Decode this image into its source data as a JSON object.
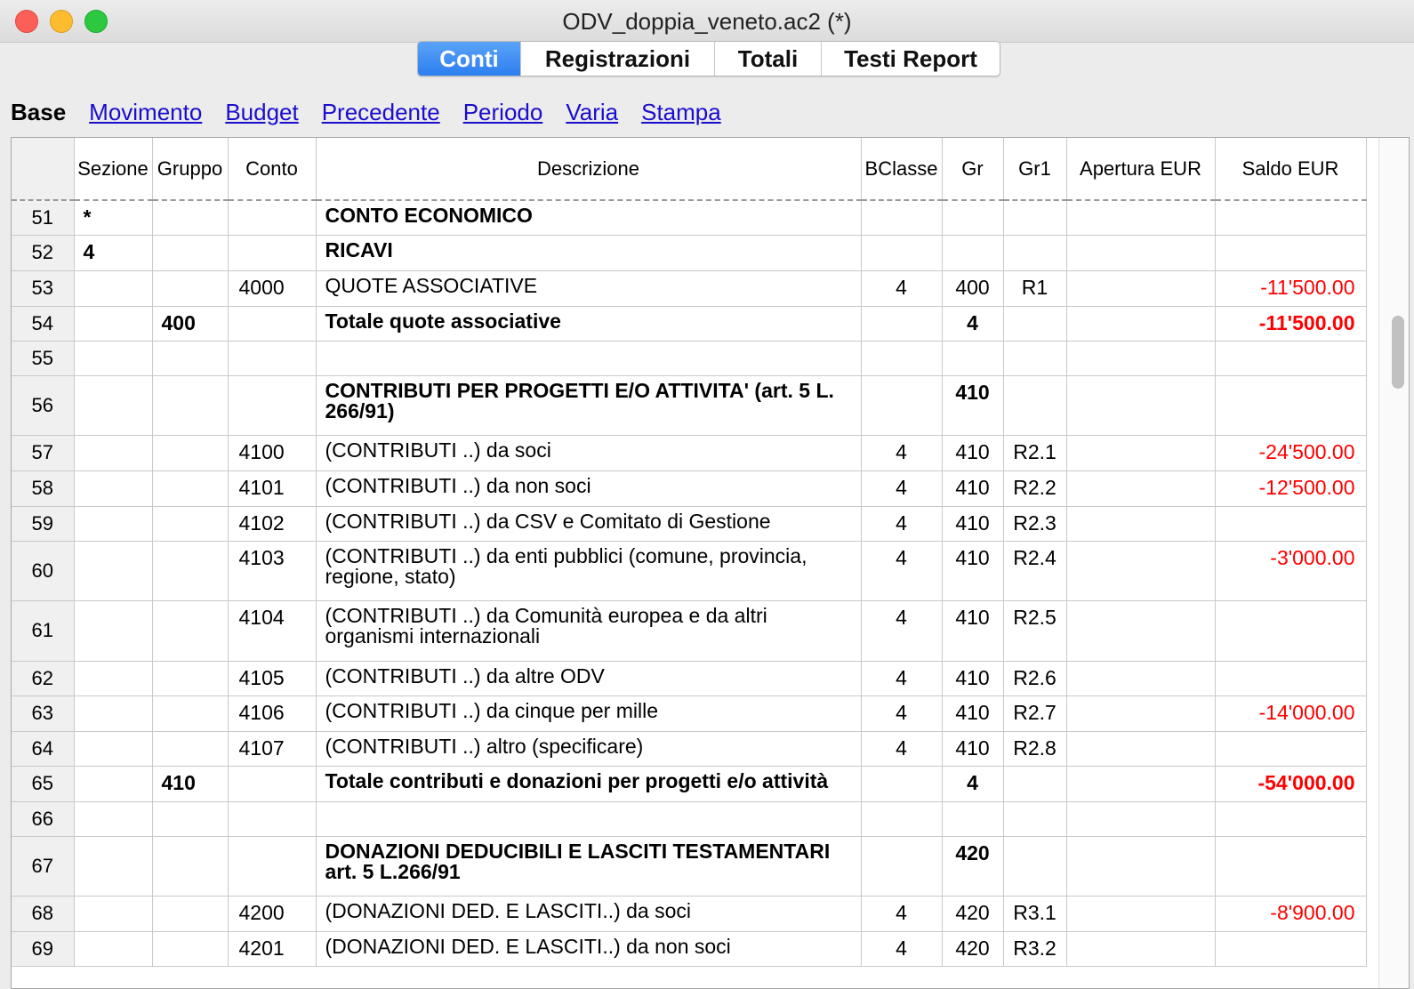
{
  "window": {
    "title": "ODV_doppia_veneto.ac2 (*)"
  },
  "tabs": [
    "Conti",
    "Registrazioni",
    "Totali",
    "Testi Report"
  ],
  "active_tab": "Conti",
  "views": {
    "base": "Base",
    "links": [
      "Movimento",
      "Budget",
      "Precedente",
      "Periodo",
      "Varia",
      "Stampa"
    ]
  },
  "columns": [
    "Sezione",
    "Gruppo",
    "Conto",
    "Descrizione",
    "BClasse",
    "Gr",
    "Gr1",
    "Apertura EUR",
    "Saldo EUR"
  ],
  "colors": {
    "negative": "#ff0000",
    "tab_active": "#2d7ff0",
    "link": "#1a0dcc"
  },
  "rows": [
    {
      "n": "51",
      "sezione": "*",
      "gruppo": "",
      "conto": "",
      "descrizione": "CONTO ECONOMICO",
      "bclasse": "",
      "gr": "",
      "gr1": "",
      "apertura": "",
      "saldo": "",
      "bold": true,
      "h": 39
    },
    {
      "n": "52",
      "sezione": "4",
      "gruppo": "",
      "conto": "",
      "descrizione": "RICAVI",
      "bclasse": "",
      "gr": "",
      "gr1": "",
      "apertura": "",
      "saldo": "",
      "bold": true,
      "h": 40
    },
    {
      "n": "53",
      "sezione": "",
      "gruppo": "",
      "conto": "4000",
      "descrizione": "QUOTE ASSOCIATIVE",
      "bclasse": "4",
      "gr": "400",
      "gr1": "R1",
      "apertura": "",
      "saldo": "-11'500.00",
      "bold": false,
      "h": 40
    },
    {
      "n": "54",
      "sezione": "",
      "gruppo": "400",
      "conto": "",
      "descrizione": "Totale quote associative",
      "bclasse": "",
      "gr": "4",
      "gr1": "",
      "apertura": "",
      "saldo": "-11'500.00",
      "bold": true,
      "h": 39
    },
    {
      "n": "55",
      "sezione": "",
      "gruppo": "",
      "conto": "",
      "descrizione": "",
      "bclasse": "",
      "gr": "",
      "gr1": "",
      "apertura": "",
      "saldo": "",
      "bold": false,
      "h": 39
    },
    {
      "n": "56",
      "sezione": "",
      "gruppo": "",
      "conto": "",
      "descrizione": "CONTRIBUTI PER PROGETTI E/O ATTIVITA'  (art. 5 L. 266/91)",
      "bclasse": "",
      "gr": "410",
      "gr1": "",
      "apertura": "",
      "saldo": "",
      "bold": true,
      "h": 67
    },
    {
      "n": "57",
      "sezione": "",
      "gruppo": "",
      "conto": "4100",
      "descrizione": "(CONTRIBUTI ..) da soci",
      "bclasse": "4",
      "gr": "410",
      "gr1": "R2.1",
      "apertura": "",
      "saldo": "-24'500.00",
      "bold": false,
      "h": 40
    },
    {
      "n": "58",
      "sezione": "",
      "gruppo": "",
      "conto": "4101",
      "descrizione": "(CONTRIBUTI ..) da non soci",
      "bclasse": "4",
      "gr": "410",
      "gr1": "R2.2",
      "apertura": "",
      "saldo": "-12'500.00",
      "bold": false,
      "h": 40
    },
    {
      "n": "59",
      "sezione": "",
      "gruppo": "",
      "conto": "4102",
      "descrizione": "(CONTRIBUTI ..)  da CSV e Comitato di Gestione",
      "bclasse": "4",
      "gr": "410",
      "gr1": "R2.3",
      "apertura": "",
      "saldo": "",
      "bold": false,
      "h": 39
    },
    {
      "n": "60",
      "sezione": "",
      "gruppo": "",
      "conto": "4103",
      "descrizione": "(CONTRIBUTI ..)  da enti pubblici (comune, provincia, regione, stato)",
      "bclasse": "4",
      "gr": "410",
      "gr1": "R2.4",
      "apertura": "",
      "saldo": "-3'000.00",
      "bold": false,
      "h": 67
    },
    {
      "n": "61",
      "sezione": "",
      "gruppo": "",
      "conto": "4104",
      "descrizione": "(CONTRIBUTI ..)  da Comunità europea e da altri organismi internazionali",
      "bclasse": "4",
      "gr": "410",
      "gr1": "R2.5",
      "apertura": "",
      "saldo": "",
      "bold": false,
      "h": 68
    },
    {
      "n": "62",
      "sezione": "",
      "gruppo": "",
      "conto": "4105",
      "descrizione": "(CONTRIBUTI ..) da altre ODV",
      "bclasse": "4",
      "gr": "410",
      "gr1": "R2.6",
      "apertura": "",
      "saldo": "",
      "bold": false,
      "h": 39
    },
    {
      "n": "63",
      "sezione": "",
      "gruppo": "",
      "conto": "4106",
      "descrizione": "(CONTRIBUTI ..) da cinque per mille",
      "bclasse": "4",
      "gr": "410",
      "gr1": "R2.7",
      "apertura": "",
      "saldo": "-14'000.00",
      "bold": false,
      "h": 40
    },
    {
      "n": "64",
      "sezione": "",
      "gruppo": "",
      "conto": "4107",
      "descrizione": "(CONTRIBUTI ..)  altro (specificare)",
      "bclasse": "4",
      "gr": "410",
      "gr1": "R2.8",
      "apertura": "",
      "saldo": "",
      "bold": false,
      "h": 39
    },
    {
      "n": "65",
      "sezione": "",
      "gruppo": "410",
      "conto": "",
      "descrizione": "Totale contributi e donazioni per progetti e/o attività",
      "bclasse": "",
      "gr": "4",
      "gr1": "",
      "apertura": "",
      "saldo": "-54'000.00",
      "bold": true,
      "h": 40
    },
    {
      "n": "66",
      "sezione": "",
      "gruppo": "",
      "conto": "",
      "descrizione": "",
      "bclasse": "",
      "gr": "",
      "gr1": "",
      "apertura": "",
      "saldo": "",
      "bold": false,
      "h": 39
    },
    {
      "n": "67",
      "sezione": "",
      "gruppo": "",
      "conto": "",
      "descrizione": "DONAZIONI DEDUCIBILI E LASCITI TESTAMENTARI art. 5 L.266/91",
      "bclasse": "",
      "gr": "420",
      "gr1": "",
      "apertura": "",
      "saldo": "",
      "bold": true,
      "h": 67
    },
    {
      "n": "68",
      "sezione": "",
      "gruppo": "",
      "conto": "4200",
      "descrizione": "(DONAZIONI DED. E LASCITI..) da soci",
      "bclasse": "4",
      "gr": "420",
      "gr1": "R3.1",
      "apertura": "",
      "saldo": "-8'900.00",
      "bold": false,
      "h": 40
    },
    {
      "n": "69",
      "sezione": "",
      "gruppo": "",
      "conto": "4201",
      "descrizione": "(DONAZIONI DED. E LASCITI..) da non soci",
      "bclasse": "4",
      "gr": "420",
      "gr1": "R3.2",
      "apertura": "",
      "saldo": "",
      "bold": false,
      "h": 39
    }
  ]
}
